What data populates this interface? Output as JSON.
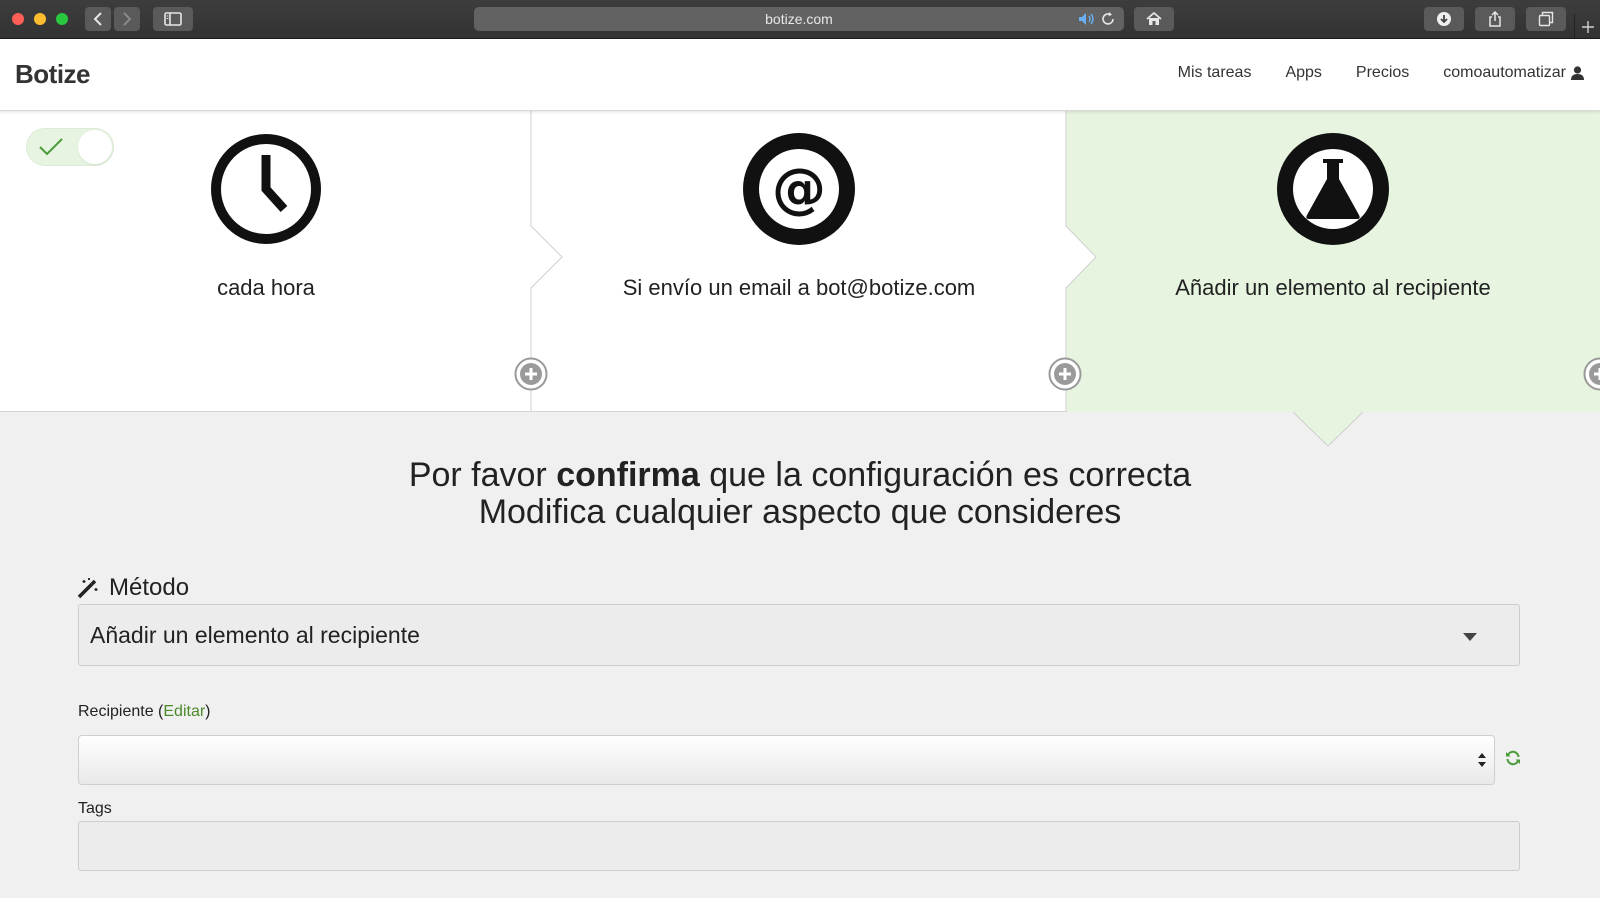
{
  "browser": {
    "url": "botize.com",
    "icons": [
      "back-icon",
      "forward-icon",
      "sidebar-icon",
      "speaker-icon",
      "reload-icon",
      "home-icon",
      "download-icon",
      "share-icon",
      "tabs-icon",
      "plus-icon"
    ]
  },
  "nav": {
    "brand": "Botize",
    "links": [
      "Mis tareas",
      "Apps",
      "Precios",
      "comoautomatizar"
    ]
  },
  "task": {
    "enabled": true,
    "steps": [
      {
        "icon": "clock-icon",
        "label": "cada hora"
      },
      {
        "icon": "at-icon",
        "label": "Si envío un email a bot@botize.com"
      },
      {
        "icon": "flask-icon",
        "label": "Añadir un elemento al recipiente",
        "active": true
      }
    ]
  },
  "headline": {
    "line1_pre": "Por favor ",
    "line1_bold": "confirma",
    "line1_post": " que la configuración es correcta",
    "line2": "Modifica cualquier aspecto que consideres"
  },
  "form": {
    "metodo_label": "Método",
    "metodo_value": "Añadir un elemento al recipiente",
    "recipiente_label": "Recipiente (",
    "recipiente_edit": "Editar",
    "recipiente_close": ")",
    "recipiente_value": "",
    "tags_label": "Tags",
    "tags_value": ""
  },
  "colors": {
    "active_step_bg": "#e7f5e0",
    "link": "#4b8a2a",
    "accent_green": "#4b9a3a"
  }
}
